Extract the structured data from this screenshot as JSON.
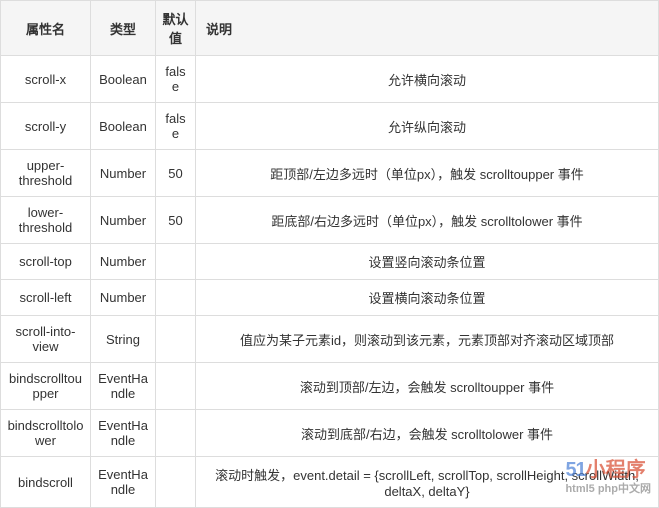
{
  "headers": {
    "name": "属性名",
    "type": "类型",
    "default": "默认值",
    "desc": "说明"
  },
  "rows": [
    {
      "name": "scroll-x",
      "type": "Boolean",
      "default": "false",
      "desc": "允许横向滚动"
    },
    {
      "name": "scroll-y",
      "type": "Boolean",
      "default": "false",
      "desc": "允许纵向滚动"
    },
    {
      "name": "upper-threshold",
      "type": "Number",
      "default": "50",
      "desc": "距顶部/左边多远时（单位px），触发 scrolltoupper 事件"
    },
    {
      "name": "lower-threshold",
      "type": "Number",
      "default": "50",
      "desc": "距底部/右边多远时（单位px），触发 scrolltolower 事件"
    },
    {
      "name": "scroll-top",
      "type": "Number",
      "default": "",
      "desc": "设置竖向滚动条位置"
    },
    {
      "name": "scroll-left",
      "type": "Number",
      "default": "",
      "desc": "设置横向滚动条位置"
    },
    {
      "name": "scroll-into-view",
      "type": "String",
      "default": "",
      "desc": "值应为某子元素id，则滚动到该元素，元素顶部对齐滚动区域顶部"
    },
    {
      "name": "bindscrolltoupper",
      "type": "EventHandle",
      "default": "",
      "desc": "滚动到顶部/左边，会触发 scrolltoupper 事件"
    },
    {
      "name": "bindscrolltolower",
      "type": "EventHandle",
      "default": "",
      "desc": "滚动到底部/右边，会触发 scrolltolower 事件"
    },
    {
      "name": "bindscroll",
      "type": "EventHandle",
      "default": "",
      "desc": "滚动时触发，event.detail = {scrollLeft, scrollTop, scrollHeight, scrollWidth, deltaX, deltaY}"
    }
  ],
  "watermark": {
    "part1": "51",
    "part2": "小程序",
    "sub": "html5 php中文网"
  }
}
